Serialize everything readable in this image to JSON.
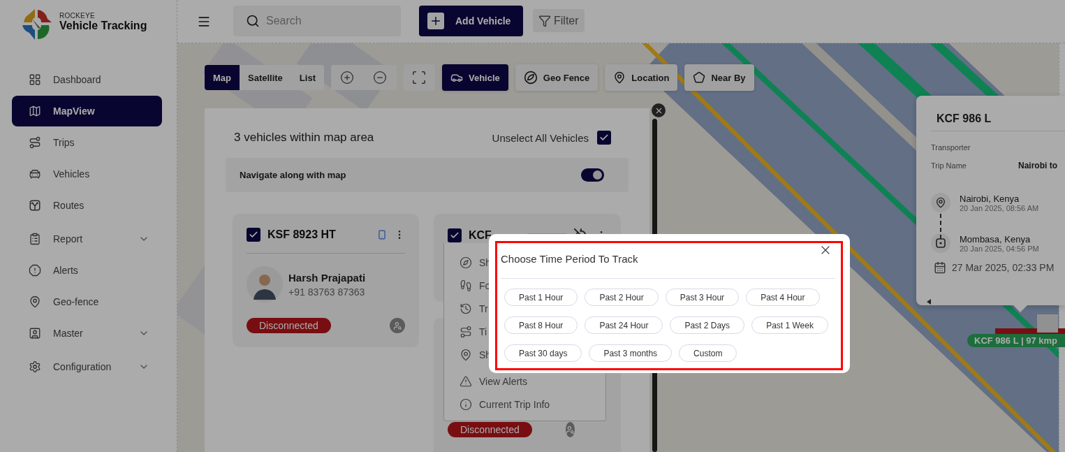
{
  "brand": {
    "company": "ROCKEYE",
    "product": "Vehicle Tracking"
  },
  "sidebar": {
    "items": [
      {
        "label": "Dashboard",
        "selected": false,
        "has_submenu": false
      },
      {
        "label": "MapView",
        "selected": true,
        "has_submenu": false
      },
      {
        "label": "Trips",
        "selected": false,
        "has_submenu": false
      },
      {
        "label": "Vehicles",
        "selected": false,
        "has_submenu": false
      },
      {
        "label": "Routes",
        "selected": false,
        "has_submenu": false
      },
      {
        "label": "Report",
        "selected": false,
        "has_submenu": true
      },
      {
        "label": "Alerts",
        "selected": false,
        "has_submenu": false
      },
      {
        "label": "Geo-fence",
        "selected": false,
        "has_submenu": false
      },
      {
        "label": "Master",
        "selected": false,
        "has_submenu": true
      },
      {
        "label": "Configuration",
        "selected": false,
        "has_submenu": true
      }
    ]
  },
  "header": {
    "search": {
      "placeholder": "Search"
    },
    "add_button": "Add Vehicle",
    "filter_button": "Filter"
  },
  "view_tabs": [
    {
      "label": "Map",
      "selected": true
    },
    {
      "label": "Satellite",
      "selected": false
    },
    {
      "label": "List",
      "selected": false
    }
  ],
  "layers": [
    {
      "label": "Vehicle",
      "selected": true
    },
    {
      "label": "Geo Fence",
      "selected": false
    },
    {
      "label": "Location",
      "selected": false
    },
    {
      "label": "Near By",
      "selected": false
    }
  ],
  "vehicle_panel": {
    "title": "3 vehicles within map area",
    "unselect_label": "Unselect All Vehicles",
    "unselect_checked": true,
    "navigate_label": "Navigate along with map",
    "navigate_on": true,
    "cards": [
      {
        "kind": "full",
        "plate": "KSF 8923 HT",
        "checked": true,
        "driver": "Harsh Prajapati",
        "phone": "+91 83763 87363",
        "status": "Disconnected"
      },
      {
        "kind": "header",
        "plate": "KCF",
        "checked": true
      },
      {
        "kind": "footer",
        "status": "Disconnected"
      }
    ],
    "menu": [
      "Sh",
      "Fo",
      "Tr",
      "Ti",
      "Sh",
      "View Alerts",
      "Current Trip Info"
    ]
  },
  "info_card": {
    "title": "KCF 986 L",
    "fields": [
      {
        "label": "Transporter"
      },
      {
        "label": "Trip Name",
        "value": "Nairobi to"
      }
    ],
    "stops": [
      {
        "kind": "origin",
        "place": "Nairobi, Kenya",
        "time": "20 Jan 2025, 08:56 AM"
      },
      {
        "kind": "destination",
        "place": "Mombasa, Kenya",
        "time": "20 Jan 2025, 04:56 PM"
      }
    ],
    "updated": "27 Mar 2025, 02:33 PM"
  },
  "map_marker": {
    "label": "KCF 986 L | 97 kmp"
  },
  "dialog": {
    "title": "Choose Time Period To Track",
    "options": [
      "Past 1 Hour",
      "Past 2 Hour",
      "Past 3 Hour",
      "Past 4 Hour",
      "Past 8 Hour",
      "Past 24 Hour",
      "Past 2 Days",
      "Past 1 Week",
      "Past 30 days",
      "Past 3 months",
      "Custom"
    ]
  }
}
